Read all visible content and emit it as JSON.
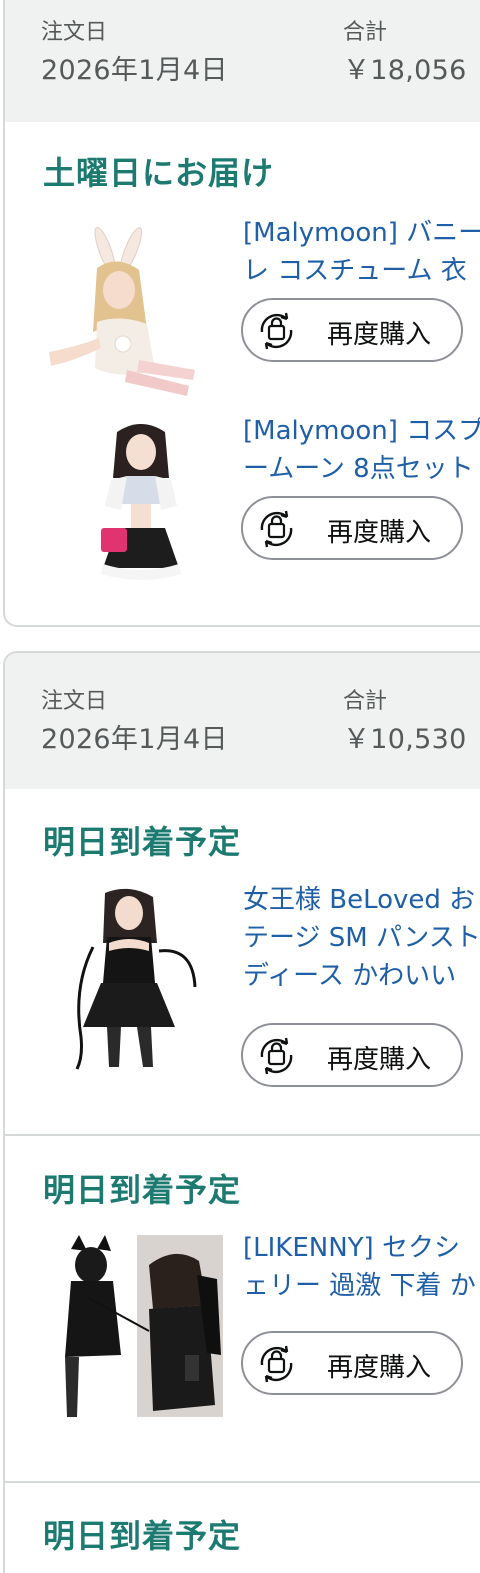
{
  "orders": [
    {
      "date_label": "注文日",
      "date_value": "2026年1月4日",
      "total_label": "合計",
      "total_value": "￥18,056",
      "shipments": [
        {
          "status": "土曜日にお届け",
          "items": [
            {
              "title_line1": "[Malymoon] バニー",
              "title_line2": "レ コスチューム 衣",
              "rebuy_label": "再度購入",
              "image": "bunny-costume-white"
            },
            {
              "title_line1": "[Malymoon] コスプ",
              "title_line2": "ームーン 8点セット",
              "rebuy_label": "再度購入",
              "image": "maid-costume"
            }
          ]
        }
      ]
    },
    {
      "date_label": "注文日",
      "date_value": "2026年1月4日",
      "total_label": "合計",
      "total_value": "￥10,530",
      "shipments": [
        {
          "status": "明日到着予定",
          "items": [
            {
              "title_line1": "女王様 BeLoved お",
              "title_line2": "テージ SM パンスト",
              "title_line3": "ディース かわいい",
              "rebuy_label": "再度購入",
              "image": "black-leather-dress"
            }
          ]
        },
        {
          "status": "明日到着予定",
          "items": [
            {
              "title_line1": "[LIKENNY] セクシ",
              "title_line2": "ェリー 過激 下着 か",
              "rebuy_label": "再度購入",
              "image": "black-bunny-costume"
            }
          ]
        },
        {
          "status": "明日到着予定",
          "items": []
        }
      ]
    }
  ],
  "colors": {
    "accent": "#1c7a70",
    "link": "#1f5fa8",
    "header_bg": "#f0f2f2",
    "border": "#d5d9d9"
  }
}
